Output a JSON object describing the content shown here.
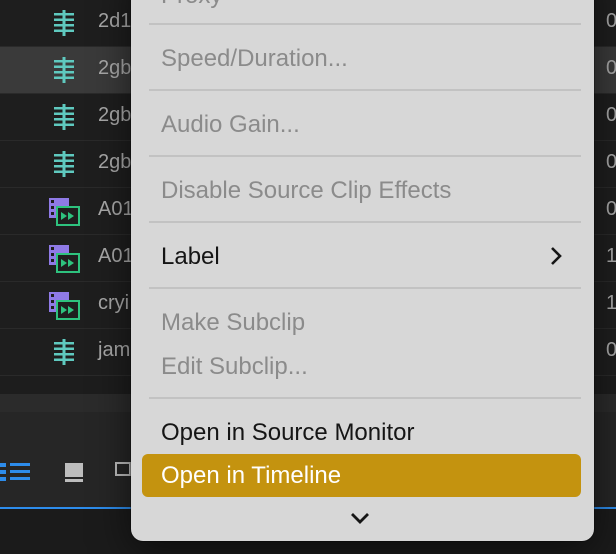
{
  "project_panel": {
    "rows": [
      {
        "name": "2d1",
        "value": "0",
        "icon": "audio-clip-icon",
        "selected": false
      },
      {
        "name": "2gb",
        "value": "0",
        "icon": "audio-clip-icon",
        "selected": true
      },
      {
        "name": "2gb",
        "value": "0",
        "icon": "audio-clip-icon",
        "selected": false
      },
      {
        "name": "2gb",
        "value": "0",
        "icon": "audio-clip-icon",
        "selected": false
      },
      {
        "name": "A01",
        "value": "0",
        "icon": "video-clip-icon",
        "selected": false
      },
      {
        "name": "A01",
        "value": "1",
        "icon": "video-clip-icon",
        "selected": false
      },
      {
        "name": "cryi",
        "value": "1",
        "icon": "video-clip-icon",
        "selected": false
      },
      {
        "name": "jam",
        "value": "0",
        "icon": "audio-clip-icon",
        "selected": false
      }
    ]
  },
  "context_menu": {
    "items": {
      "proxy": "Proxy",
      "speed_duration": "Speed/Duration...",
      "audio_gain": "Audio Gain...",
      "disable_source_clip_effects": "Disable Source Clip Effects",
      "label": "Label",
      "make_subclip": "Make Subclip",
      "edit_subclip": "Edit Subclip...",
      "open_in_source_monitor": "Open in Source Monitor",
      "open_in_timeline": "Open in Timeline"
    },
    "highlight_color": "#c4930f"
  },
  "colors": {
    "audio_icon": "#5fc9bf",
    "video_icon_purple": "#8f7ae6",
    "video_icon_green": "#2ec27e",
    "accent_blue": "#2d8ceb"
  }
}
